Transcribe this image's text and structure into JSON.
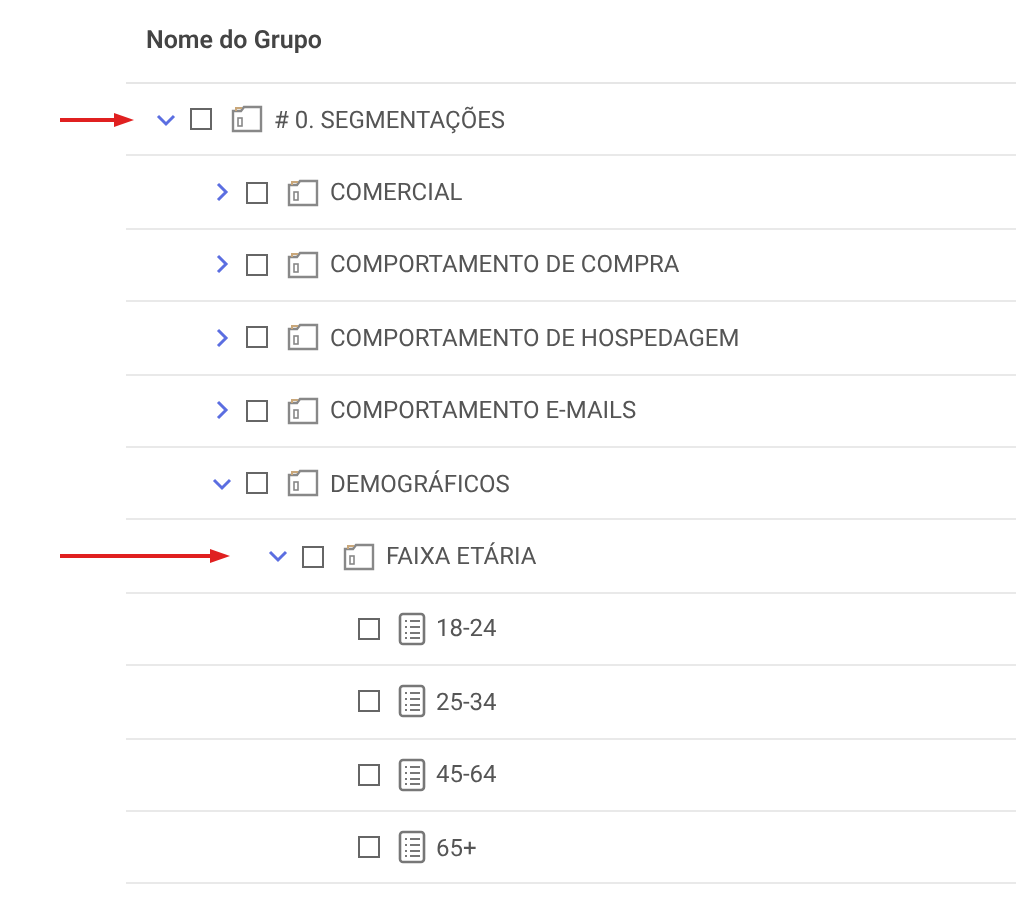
{
  "table": {
    "column_header": "Nome do Grupo",
    "tree": [
      {
        "label": "# 0. SEGMENTAÇÕES",
        "kind": "folder",
        "expanded": true,
        "checked": false,
        "marked": true,
        "children": [
          {
            "label": "COMERCIAL",
            "kind": "folder",
            "expanded": false,
            "checked": false,
            "marked": false
          },
          {
            "label": "COMPORTAMENTO DE COMPRA",
            "kind": "folder",
            "expanded": false,
            "checked": false,
            "marked": false
          },
          {
            "label": "COMPORTAMENTO DE HOSPEDAGEM",
            "kind": "folder",
            "expanded": false,
            "checked": false,
            "marked": false
          },
          {
            "label": "COMPORTAMENTO E-MAILS",
            "kind": "folder",
            "expanded": false,
            "checked": false,
            "marked": false
          },
          {
            "label": "DEMOGRÁFICOS",
            "kind": "folder",
            "expanded": true,
            "checked": false,
            "marked": false,
            "children": [
              {
                "label": "FAIXA ETÁRIA",
                "kind": "folder",
                "expanded": true,
                "checked": false,
                "marked": true,
                "children": [
                  {
                    "label": "18-24",
                    "kind": "list",
                    "checked": false,
                    "marked": false
                  },
                  {
                    "label": "25-34",
                    "kind": "list",
                    "checked": false,
                    "marked": false
                  },
                  {
                    "label": "45-64",
                    "kind": "list",
                    "checked": false,
                    "marked": false
                  },
                  {
                    "label": "65+",
                    "kind": "list",
                    "checked": false,
                    "marked": false
                  }
                ]
              }
            ]
          }
        ]
      }
    ]
  }
}
